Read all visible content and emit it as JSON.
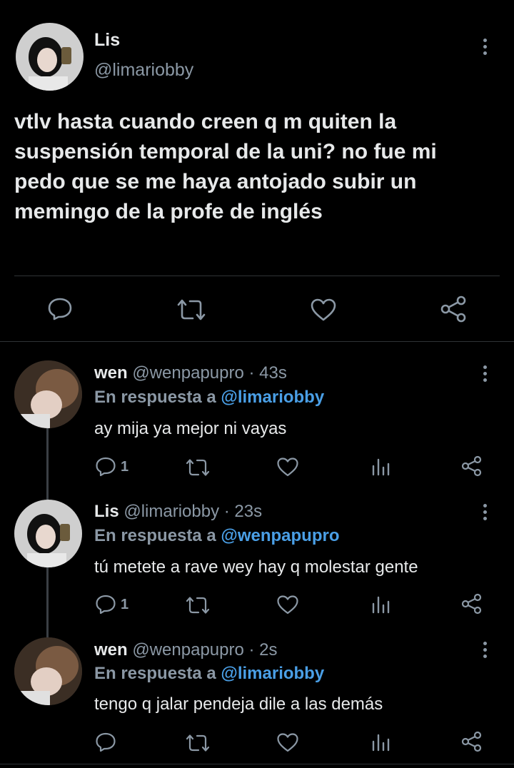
{
  "main_tweet": {
    "display_name": "Lis",
    "handle": "@limariobby",
    "text_lines": [
      "vtlv hasta cuando creen q m quiten la",
      "suspensión temporal de la uni? no fue mi",
      "pedo que se me haya antojado subir un",
      "memingo de la profe de inglés"
    ],
    "actions": [
      "reply-icon",
      "retweet-icon",
      "like-icon",
      "share-icon"
    ]
  },
  "replies": [
    {
      "display_name": "wen",
      "handle": "@wenpapupro",
      "time": "· 43s",
      "replying_prefix": "En respuesta a",
      "replying_to": "@limariobby",
      "text": "ay mija ya mejor ni vayas",
      "reply_count": "1"
    },
    {
      "display_name": "Lis",
      "handle": "@limariobby",
      "time": "· 23s",
      "replying_prefix": "En respuesta a",
      "replying_to": "@wenpapupro",
      "text": "tú metete a rave wey hay q molestar gente",
      "reply_count": "1"
    },
    {
      "display_name": "wen",
      "handle": "@wenpapupro",
      "time": "· 2s",
      "replying_prefix": "En respuesta a",
      "replying_to": "@limariobby",
      "text": "tengo q jalar pendeja dile a las demás",
      "reply_count": ""
    }
  ],
  "colors": {
    "background": "#000000",
    "text": "#e7e9ea",
    "muted": "#8b98a5",
    "link": "#4a9fe6"
  }
}
